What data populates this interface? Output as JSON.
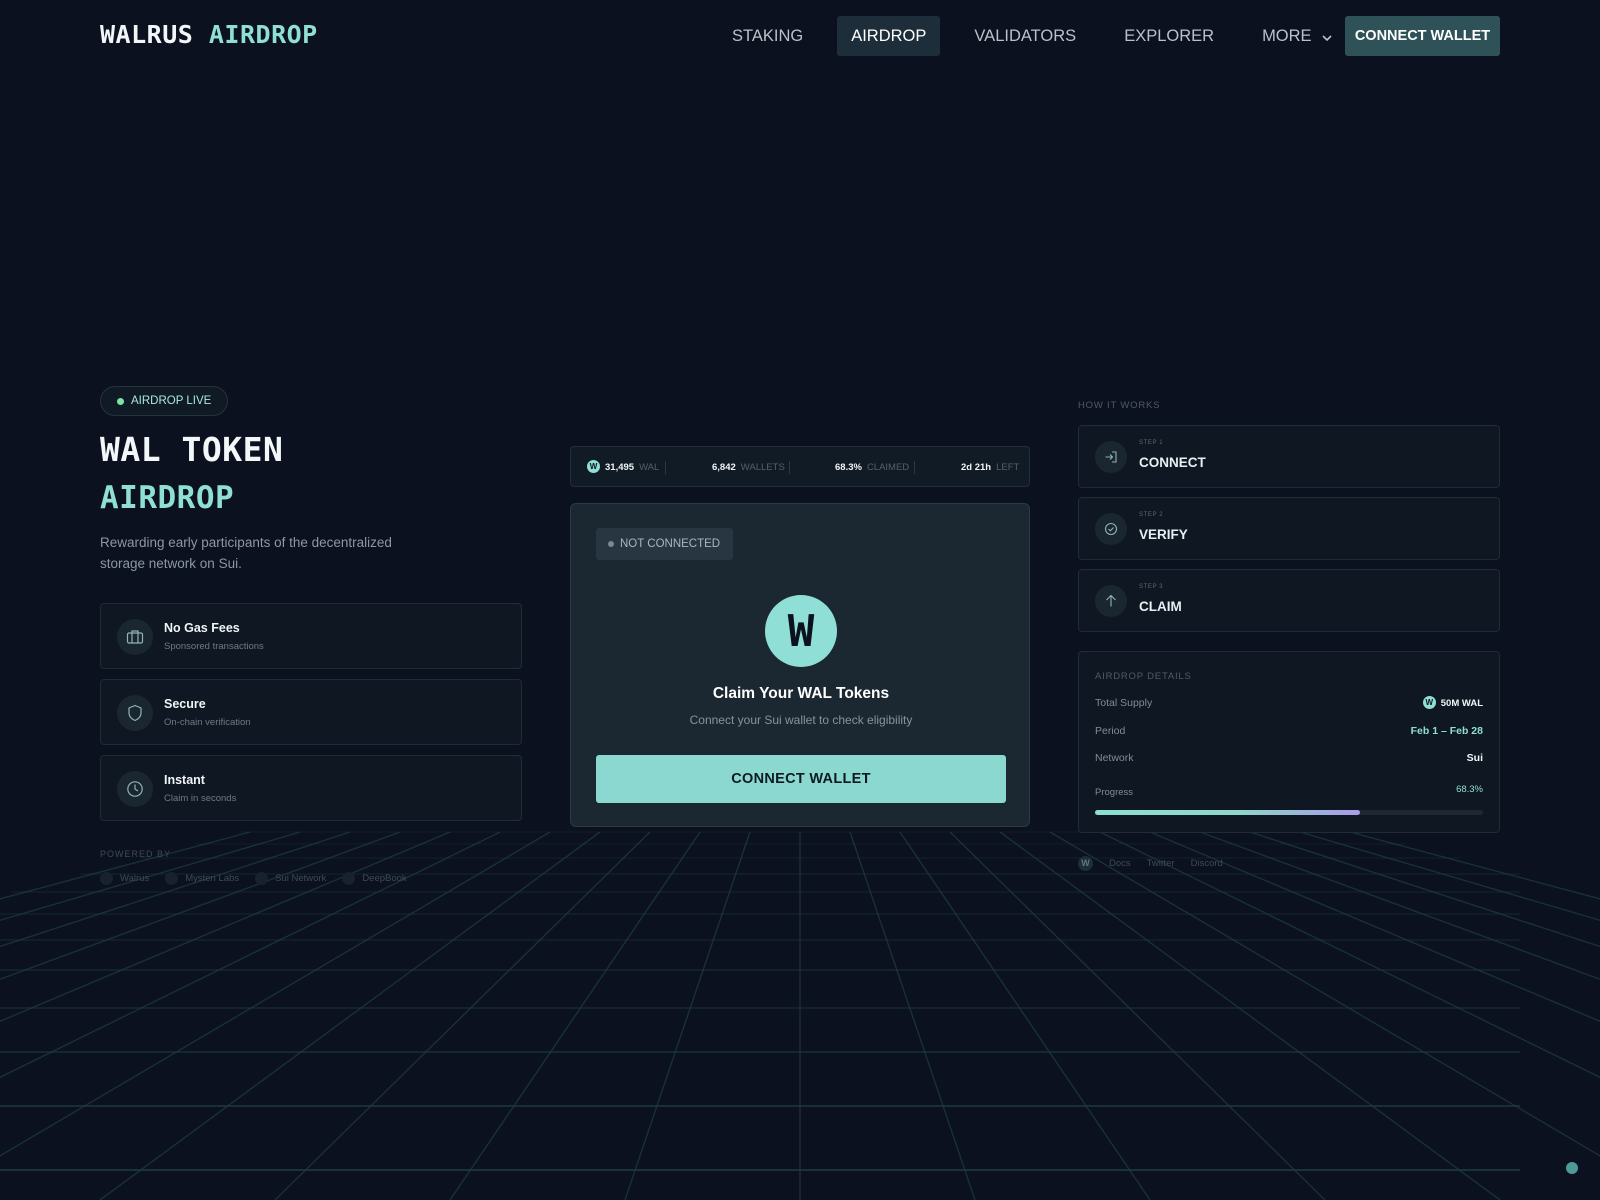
{
  "nav": {
    "logo_part1": "WALRUS",
    "logo_part2": "AIRDROP",
    "items": [
      {
        "label": "STAKING"
      },
      {
        "label": "AIRDROP"
      },
      {
        "label": "VALIDATORS"
      },
      {
        "label": "EXPLORER"
      },
      {
        "label": "MORE"
      }
    ],
    "connect_label": "CONNECT WALLET"
  },
  "hero": {
    "badge": "AIRDROP LIVE",
    "title_line1": "WAL TOKEN",
    "title_line2": "AIRDROP",
    "subtitle": "Rewarding early participants of the decentralized storage network on Sui."
  },
  "features": [
    {
      "title": "No Gas Fees",
      "subtitle": "Sponsored transactions",
      "icon": "wallet-icon"
    },
    {
      "title": "Secure",
      "subtitle": "On-chain verification",
      "icon": "shield-icon"
    },
    {
      "title": "Instant",
      "subtitle": "Claim in seconds",
      "icon": "clock-icon"
    }
  ],
  "powered": {
    "label": "POWERED BY",
    "partners": [
      "Walrus",
      "Mysten Labs",
      "Sui Network",
      "DeepBook"
    ]
  },
  "stats": {
    "logo_letter": "W",
    "items": [
      {
        "value": "31,495",
        "unit": "WAL"
      },
      {
        "value": "6,842",
        "unit": "WALLETS"
      },
      {
        "value": "68.3%",
        "unit": "CLAIMED"
      },
      {
        "value": "2d 21h",
        "unit": "LEFT"
      }
    ]
  },
  "claim": {
    "status": "NOT CONNECTED",
    "logo_letter": "W",
    "title": "Claim Your WAL Tokens",
    "subtitle": "Connect your Sui wallet to check eligibility",
    "button": "CONNECT WALLET"
  },
  "how": {
    "label": "HOW IT WORKS",
    "steps": [
      {
        "number": "STEP 1",
        "label": "CONNECT",
        "icon": "login-arrow-icon"
      },
      {
        "number": "STEP 2",
        "label": "VERIFY",
        "icon": "check-circle-icon"
      },
      {
        "number": "STEP 3",
        "label": "CLAIM",
        "icon": "arrow-up-icon"
      }
    ]
  },
  "details": {
    "label": "AIRDROP DETAILS",
    "total_supply_key": "Total Supply",
    "total_supply_value": "50M WAL",
    "logo_letter": "W",
    "period_key": "Period",
    "period_value": "Feb 1 – Feb 28",
    "network_key": "Network",
    "network_value": "Sui",
    "progress_key": "Progress",
    "progress_text": "68.3%",
    "progress_fraction": 0.683
  },
  "footer": {
    "logo_letter": "W",
    "links": [
      "Docs",
      "Twitter",
      "Discord"
    ]
  },
  "colors": {
    "background": "#0b111e",
    "accent": "#8fdfd6",
    "grid_line": "#1d3b44",
    "card": "#1b2731",
    "live_dot": "#7fe3a8"
  }
}
